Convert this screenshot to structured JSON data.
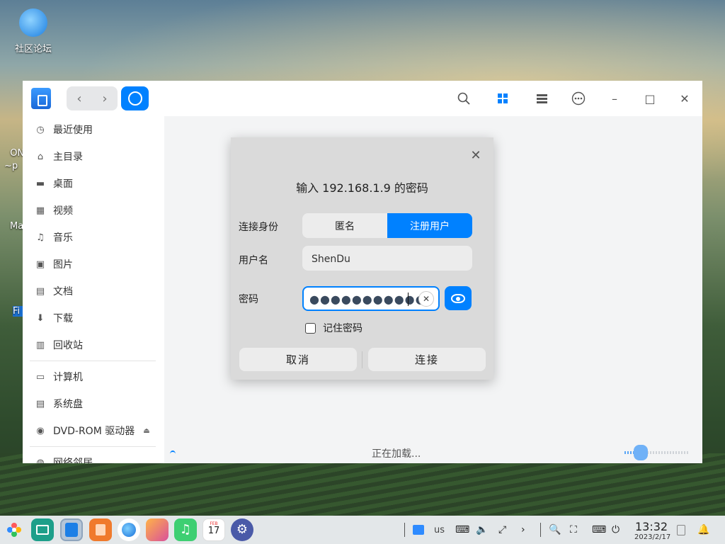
{
  "desktop": {
    "icons": [
      {
        "label": "社区论坛"
      },
      {
        "label": "ON\n~p"
      },
      {
        "label": "Ma"
      },
      {
        "label": "Fi"
      }
    ]
  },
  "window": {
    "nav_back": "‹",
    "nav_forward": "›",
    "toolbar": {
      "search": "search-icon",
      "grid_view": "grid-view-icon",
      "list_view": "list-view-icon",
      "more": "more-icon",
      "minimize": "–",
      "maximize": "□",
      "close": "✕"
    },
    "sidebar": {
      "items": [
        {
          "label": "最近使用",
          "icon": "clock-icon"
        },
        {
          "label": "主目录",
          "icon": "home-icon"
        },
        {
          "label": "桌面",
          "icon": "desktop-icon"
        },
        {
          "label": "视频",
          "icon": "video-icon"
        },
        {
          "label": "音乐",
          "icon": "music-icon"
        },
        {
          "label": "图片",
          "icon": "picture-icon"
        },
        {
          "label": "文档",
          "icon": "document-icon"
        },
        {
          "label": "下载",
          "icon": "download-icon"
        },
        {
          "label": "回收站",
          "icon": "trash-icon"
        }
      ],
      "devices": [
        {
          "label": "计算机",
          "icon": "computer-icon"
        },
        {
          "label": "系统盘",
          "icon": "disk-icon"
        },
        {
          "label": "DVD-ROM 驱动器",
          "icon": "dvd-icon"
        }
      ],
      "network": [
        {
          "label": "网络邻居",
          "icon": "network-icon"
        }
      ]
    },
    "status": {
      "loading_text": "正在加载...",
      "zoom_level": 0.15
    }
  },
  "dialog": {
    "title": "输入 192.168.1.9 的密码",
    "identity_label": "连接身份",
    "identity_options": [
      "匿名",
      "注册用户"
    ],
    "identity_selected": "注册用户",
    "username_label": "用户名",
    "username_value": "ShenDu",
    "password_label": "密码",
    "password_mask": "●●●●●●●●●●●",
    "remember_label": "记住密码",
    "remember_checked": false,
    "cancel_label": "取消",
    "connect_label": "连接"
  },
  "taskbar": {
    "keyboard_layout": "us",
    "time": "13:32",
    "date": "2023/2/17",
    "calendar_day": "17",
    "calendar_month": "FEB"
  },
  "colors": {
    "accent": "#0081ff"
  }
}
